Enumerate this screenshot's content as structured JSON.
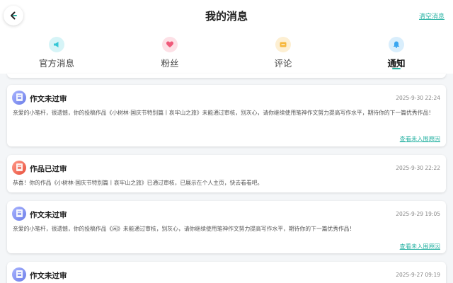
{
  "header": {
    "title": "我的消息",
    "clear_label": "清空消息"
  },
  "colors": {
    "accent": "#2bb3a4",
    "official": "#36c7d6",
    "fans": "#ef5a7a",
    "comment": "#f6b73c",
    "notice": "#3aa6f0",
    "review_fail": "#7d8cf0",
    "review_pass": "#f0604c"
  },
  "tabs": [
    {
      "label": "官方消息",
      "icon": "megaphone-icon",
      "active": false
    },
    {
      "label": "粉丝",
      "icon": "heart-icon",
      "active": false
    },
    {
      "label": "评论",
      "icon": "comment-icon",
      "active": false
    },
    {
      "label": "通知",
      "icon": "bell-icon",
      "active": true
    }
  ],
  "messages": [
    {
      "title": "作文未过审",
      "time": "2025-9-30 22:24",
      "body": "亲爱的小笔杆，很遗憾，你的投稿作品《小树林·国庆节特别篇丨哀牢山之旅》未能通过审核，别灰心，请你继续使用笔神作文努力提高写作水平，期待你的下一篇优秀作品！",
      "link": "查看未入围原因",
      "icon": "document-icon"
    },
    {
      "title": "作品已过审",
      "time": "2025-9-30 22:22",
      "body": "恭喜！你的作品《小树林·国庆节特别篇丨哀牢山之旅》已通过审核，已展示在个人主页，快去看看吧。",
      "link": "",
      "icon": "document-icon"
    },
    {
      "title": "作文未过审",
      "time": "2025-9-29 19:05",
      "body": "亲爱的小笔杆，很遗憾，你的投稿作品《闲》未能通过审核，别灰心，请你继续使用笔神作文努力提高写作水平，期待你的下一篇优秀作品！",
      "link": "查看未入围原因",
      "icon": "document-icon"
    },
    {
      "title": "作文未过审",
      "time": "2025-9-27 09:19",
      "body": "",
      "link": "",
      "icon": "document-icon"
    }
  ]
}
